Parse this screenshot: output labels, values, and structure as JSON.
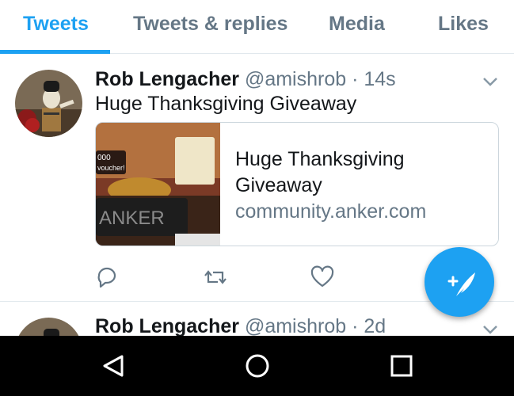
{
  "tabs": [
    {
      "label": "Tweets",
      "active": true
    },
    {
      "label": "Tweets & replies",
      "active": false
    },
    {
      "label": "Media",
      "active": false
    },
    {
      "label": "Likes",
      "active": false
    }
  ],
  "tweets": [
    {
      "author_name": "Rob Lengacher",
      "handle": "@amishrob",
      "separator": "·",
      "time": "14s",
      "text": "Huge Thanksgiving Giveaway",
      "card": {
        "title": "Huge Thanksgiving Giveaway",
        "domain": "community.anker.com",
        "image_text": {
          "brand": "ANKER",
          "voucher": "voucher!",
          "amount": "000"
        }
      }
    },
    {
      "author_name": "Rob Lengacher",
      "handle": "@amishrob",
      "separator": "·",
      "time": "2d"
    }
  ],
  "icons": {
    "reply": "reply-icon",
    "retweet": "retweet-icon",
    "like": "heart-icon",
    "compose": "compose-icon",
    "menu": "chevron-down-icon",
    "back": "back-icon",
    "home": "home-icon",
    "recents": "recents-icon"
  },
  "colors": {
    "accent": "#1da1f2",
    "secondary_text": "#657786",
    "primary_text": "#14171a",
    "nav_bar": "#000000"
  }
}
